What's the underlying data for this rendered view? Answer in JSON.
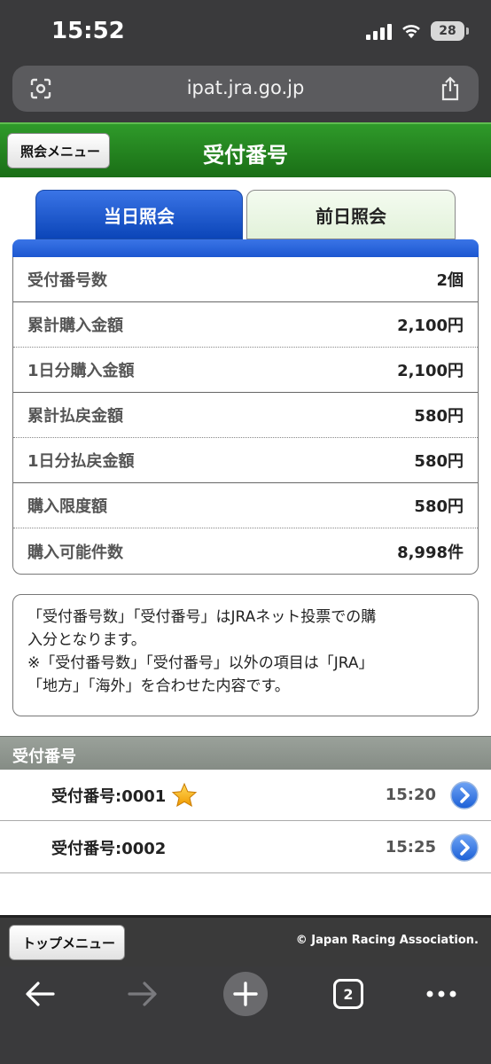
{
  "status_bar": {
    "time": "15:52",
    "battery": "28"
  },
  "browser": {
    "url": "ipat.jra.go.jp",
    "tab_count": "2"
  },
  "header": {
    "title": "受付番号",
    "back_label": "照会メニュー"
  },
  "tabs": [
    {
      "label": "当日照会",
      "active": true
    },
    {
      "label": "前日照会",
      "active": false
    }
  ],
  "summary": [
    {
      "label": "受付番号数",
      "value": "2個"
    },
    {
      "label": "累計購入金額",
      "value": "2,100円"
    },
    {
      "label": "1日分購入金額",
      "value": "2,100円"
    },
    {
      "label": "累計払戻金額",
      "value": "580円"
    },
    {
      "label": "1日分払戻金額",
      "value": "580円"
    },
    {
      "label": "購入限度額",
      "value": "580円"
    },
    {
      "label": "購入可能件数",
      "value": "8,998件"
    }
  ],
  "note": {
    "line1": "「受付番号数」「受付番号」はJRAネット投票での購",
    "line2": "入分となります。",
    "line3": "※「受付番号数」「受付番号」以外の項目は「JRA」",
    "line4": "「地方」「海外」を合わせた内容です。"
  },
  "receipts": {
    "section_title": "受付番号",
    "items": [
      {
        "label": "受付番号:0001",
        "time": "15:20",
        "starred": true
      },
      {
        "label": "受付番号:0002",
        "time": "15:25",
        "starred": false
      }
    ]
  },
  "footer": {
    "top_menu_label": "トップメニュー",
    "copyright": "© Japan Racing Association."
  },
  "colors": {
    "green": "#1f7d1a",
    "blue_tab": "#0b45b8",
    "dark_bar": "#3a3a3c"
  }
}
